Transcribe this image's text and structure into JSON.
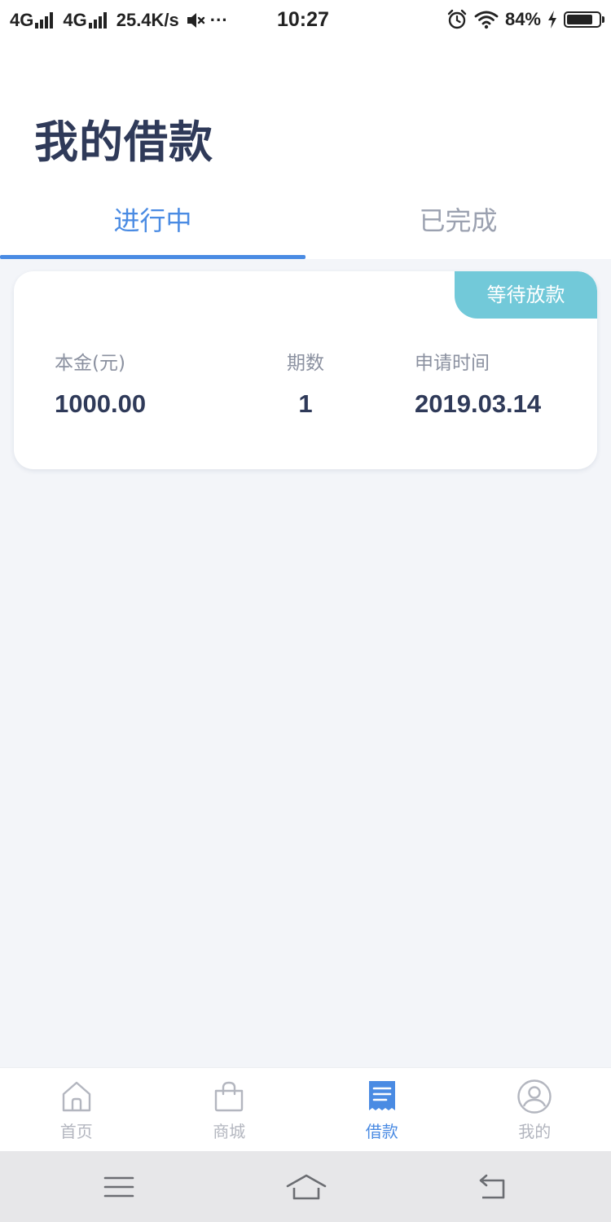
{
  "status_bar": {
    "network_1": "4G",
    "network_2": "4G",
    "speed": "25.4K/s",
    "more": "···",
    "time": "10:27",
    "battery": "84%",
    "battery_level": 0.84
  },
  "header": {
    "title": "我的借款",
    "tabs": [
      {
        "label": "进行中",
        "active": true
      },
      {
        "label": "已完成",
        "active": false
      }
    ]
  },
  "loan_card": {
    "status": "等待放款",
    "principal_label": "本金(元)",
    "principal_value": "1000.00",
    "periods_label": "期数",
    "periods_value": "1",
    "apply_time_label": "申请时间",
    "apply_time_value": "2019.03.14"
  },
  "bottom_nav": {
    "items": [
      {
        "label": "首页",
        "icon": "home-icon",
        "active": false
      },
      {
        "label": "商城",
        "icon": "shopping-bag-icon",
        "active": false
      },
      {
        "label": "借款",
        "icon": "receipt-icon",
        "active": true
      },
      {
        "label": "我的",
        "icon": "user-icon",
        "active": false
      }
    ]
  },
  "system_nav": {
    "icons": [
      "menu-icon",
      "home-outline-icon",
      "back-icon"
    ]
  },
  "colors": {
    "accent": "#4a8be3",
    "badge": "#72c9d9",
    "title": "#2f3a59",
    "muted": "#9ba1b0",
    "page_bg": "#f3f5f9"
  }
}
